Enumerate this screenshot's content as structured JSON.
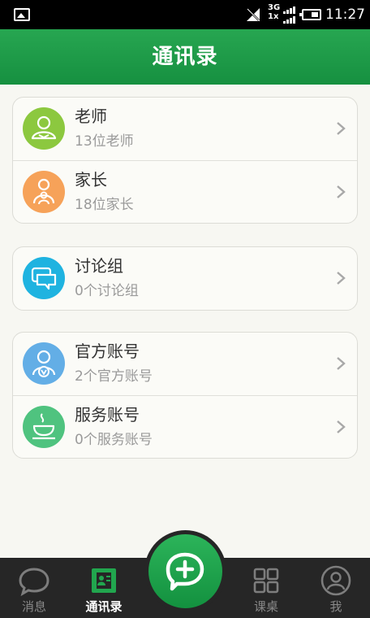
{
  "status_bar": {
    "network_label_top": "3G",
    "network_label_bottom": "1x",
    "time": "11:27",
    "icons": [
      "picture-icon",
      "signal-off-icon",
      "signal-bars-icon",
      "battery-icon"
    ]
  },
  "header": {
    "title": "通讯录"
  },
  "groups": [
    {
      "items": [
        {
          "name": "老师",
          "sub": "13位老师",
          "icon": "teacher-icon",
          "color": "#8cc83f"
        },
        {
          "name": "家长",
          "sub": "18位家长",
          "icon": "parent-icon",
          "color": "#f6a259"
        }
      ]
    },
    {
      "items": [
        {
          "name": "讨论组",
          "sub": "0个讨论组",
          "icon": "chat-group-icon",
          "color": "#1fb3e0"
        }
      ]
    },
    {
      "items": [
        {
          "name": "官方账号",
          "sub": "2个官方账号",
          "icon": "official-account-icon",
          "color": "#63aee6"
        },
        {
          "name": "服务账号",
          "sub": "0个服务账号",
          "icon": "service-account-icon",
          "color": "#4fc37f"
        }
      ]
    }
  ],
  "tabbar": {
    "tabs": [
      {
        "label": "消息",
        "icon": "message-icon",
        "active": false
      },
      {
        "label": "通讯录",
        "icon": "contacts-icon",
        "active": true
      },
      {
        "label": "课桌",
        "icon": "desk-grid-icon",
        "active": false
      },
      {
        "label": "我",
        "icon": "profile-icon",
        "active": false
      }
    ],
    "center_button_icon": "add-chat-icon"
  },
  "colors": {
    "brand_green": "#1f9b49",
    "tabbar_bg": "#262626"
  }
}
